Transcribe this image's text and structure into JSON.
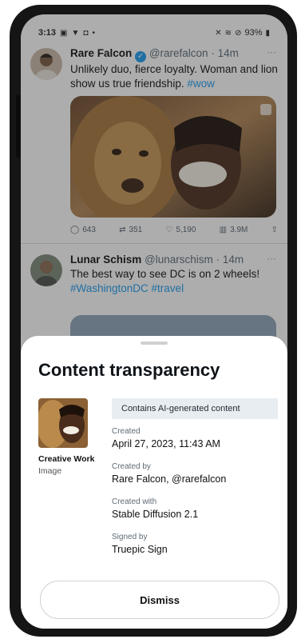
{
  "status_bar": {
    "time": "3:13",
    "battery": "93%"
  },
  "tweets": [
    {
      "name": "Rare Falcon",
      "handle": "@rarefalcon",
      "time": "14m",
      "text": "Unlikely duo, fierce loyalty. Woman and lion show us true friendship.",
      "hashtag": "#wow",
      "actions": {
        "replies": "643",
        "retweets": "351",
        "likes": "5,190",
        "views": "3.9M"
      }
    },
    {
      "name": "Lunar Schism",
      "handle": "@lunarschism",
      "time": "14m",
      "text": "The best way to see DC is on 2 wheels!",
      "hashtags": "#WashingtonDC #travel"
    }
  ],
  "sheet": {
    "title": "Content transparency",
    "work_title": "Creative Work",
    "work_type": "Image",
    "badge": "Contains AI-generated content",
    "fields": [
      {
        "label": "Created",
        "value": "April 27, 2023, 11:43 AM"
      },
      {
        "label": "Created by",
        "value": "Rare Falcon, @rarefalcon"
      },
      {
        "label": "Created with",
        "value": "Stable Diffusion 2.1"
      },
      {
        "label": "Signed by",
        "value": "Truepic Sign"
      }
    ],
    "dismiss_label": "Dismiss"
  },
  "icons": [
    "mute-icon",
    "wifi-icon",
    "alarm-icon",
    "battery-icon",
    "verified-icon",
    "reply-icon",
    "retweet-icon",
    "like-icon",
    "views-icon",
    "share-icon",
    "content-credentials-icon"
  ]
}
